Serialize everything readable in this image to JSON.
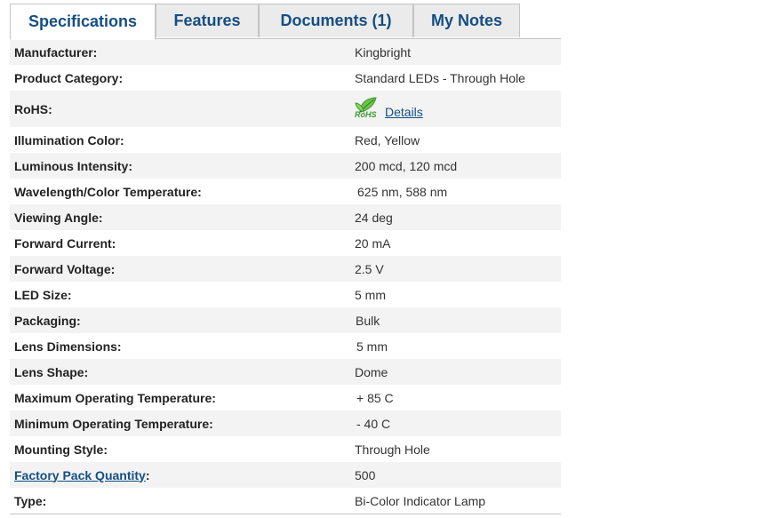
{
  "tabs": [
    {
      "label": "Specifications",
      "active": true
    },
    {
      "label": "Features",
      "active": false
    },
    {
      "label": "Documents (1)",
      "active": false
    },
    {
      "label": "My Notes",
      "active": false
    }
  ],
  "specs": [
    {
      "label": "Manufacturer:",
      "value": "Kingbright"
    },
    {
      "label": "Product Category:",
      "value": "Standard LEDs - Through Hole"
    },
    {
      "label": "RoHS:",
      "value": "Details",
      "badge": "RoHS"
    },
    {
      "label": "Illumination Color:",
      "value": "Red, Yellow"
    },
    {
      "label": "Luminous Intensity:",
      "value": "200 mcd, 120 mcd"
    },
    {
      "label": "Wavelength/Color Temperature:",
      "value": "625 nm, 588 nm"
    },
    {
      "label": "Viewing Angle:",
      "value": "24 deg"
    },
    {
      "label": "Forward Current:",
      "value": "20 mA"
    },
    {
      "label": "Forward Voltage:",
      "value": "2.5 V"
    },
    {
      "label": "LED Size:",
      "value": "5 mm"
    },
    {
      "label": "Packaging:",
      "value": "Bulk"
    },
    {
      "label": "Lens Dimensions:",
      "value": "5 mm"
    },
    {
      "label": "Lens Shape:",
      "value": "Dome"
    },
    {
      "label": "Maximum Operating Temperature:",
      "value": "+ 85 C"
    },
    {
      "label": "Minimum Operating Temperature:",
      "value": "- 40 C"
    },
    {
      "label": "Mounting Style:",
      "value": "Through Hole"
    },
    {
      "label": "Factory Pack Quantity",
      "label_suffix": ":",
      "value": "500"
    },
    {
      "label": "Type:",
      "value": "Bi-Color Indicator Lamp"
    }
  ],
  "colors": {
    "accent": "#144e84",
    "row_alt": "#f3f3f3",
    "rohs_green": "#3a9a2a"
  }
}
